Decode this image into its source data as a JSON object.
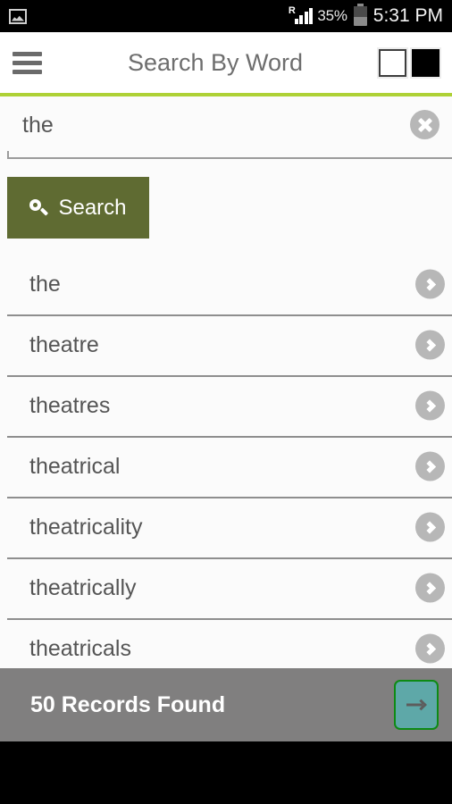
{
  "status_bar": {
    "notification_icon": "image-icon",
    "roaming_indicator": "R",
    "signal_icon": "signal-bars-icon",
    "battery_percent": "35%",
    "battery_icon": "battery-icon",
    "time": "5:31 PM"
  },
  "app_bar": {
    "menu_icon": "hamburger-menu-icon",
    "title": "Search By Word",
    "action_outline_icon": "square-outline-icon",
    "action_filled_icon": "square-filled-icon"
  },
  "accent_color": "#aed136",
  "search": {
    "value": "the",
    "placeholder": "Search By Word",
    "clear_icon": "clear-circle-icon",
    "button_label": "Search",
    "button_icon": "search-icon",
    "button_color": "#5f6b32"
  },
  "results": {
    "items": [
      {
        "word": "the"
      },
      {
        "word": "theatre"
      },
      {
        "word": "theatres"
      },
      {
        "word": "theatrical"
      },
      {
        "word": "theatricality"
      },
      {
        "word": "theatrically"
      },
      {
        "word": "theatricals"
      }
    ],
    "row_chevron_icon": "chevron-right-icon"
  },
  "footer": {
    "records_text": "50 Records Found",
    "next_icon": "arrow-right-icon",
    "next_button_color": "#5ea8a8",
    "bar_color": "#807f7f"
  }
}
